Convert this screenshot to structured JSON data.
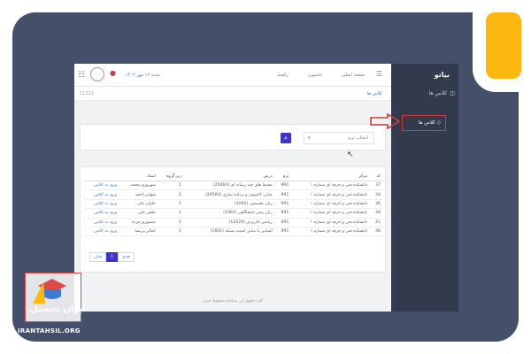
{
  "colors": {
    "frame": "#44506a",
    "accent_yellow": "#fcb711",
    "sidebar": "#323b4e",
    "primary": "#3d35c9",
    "highlight_red": "#d23a3a"
  },
  "sidebar": {
    "brand": "بیاتو",
    "section": "کلاس ها",
    "item": "کلاس ها"
  },
  "topbar": {
    "date": "شنبه ۱۲ مهر ۱۴۰۲",
    "nav": [
      "صفحه اصلی",
      "داشبورد",
      "راهنما"
    ]
  },
  "breadcrumb": {
    "title": "کلاس ها",
    "code": "11122"
  },
  "search": {
    "select_placeholder": "انتخاب ترم"
  },
  "table": {
    "headers": [
      "کد",
      "مرکز",
      "ترم",
      "درس",
      "زیر گروه",
      "استاد",
      ""
    ],
    "rows": [
      [
        "37",
        "دانشکده فنی و حرفه ای شماره ۱",
        "991",
        "محیط های چند رسانه ای (25064)",
        "1",
        "شهروزی,محمد",
        "ورود به کلاس"
      ],
      [
        "34",
        "دانشکده فنی و حرفه ای شماره ۱",
        "991",
        "مبانی کامپیوتر و برنامه سازی (24504)",
        "1",
        "شهابی,احمد",
        "ورود به کلاس"
      ],
      [
        "36",
        "دانشکده فنی و حرفه ای شماره ۱",
        "991",
        "زبان تخصصی (1092)",
        "1",
        "خلیلی,علی",
        "ورود به کلاس"
      ],
      [
        "39",
        "دانشکده فنی و حرفه ای شماره ۱",
        "991",
        "زبان پیش دانشگاهی (1061)",
        "1",
        "نجفی,علی",
        "ورود به کلاس"
      ],
      [
        "41",
        "دانشکده فنی و حرفه ای شماره ۱",
        "991",
        "ریاضی کاربردی (12478)",
        "1",
        "منصوری,مژده",
        "ورود به کلاس"
      ],
      [
        "46",
        "دانشکده فنی و حرفه ای شماره ۱",
        "991",
        "آشنایی با مبانی امنیت شبکه (1601)",
        "1",
        "کمالی,پریسا",
        "ورود به کلاس"
      ]
    ]
  },
  "pager": {
    "prev": "قبلی",
    "page": "1",
    "next": "بعدی"
  },
  "footer": "کلیه حقوق این سامانه محفوظ است",
  "logo": {
    "name": "ایران تحصیل",
    "site": "IRANTAHSIL.ORG"
  }
}
